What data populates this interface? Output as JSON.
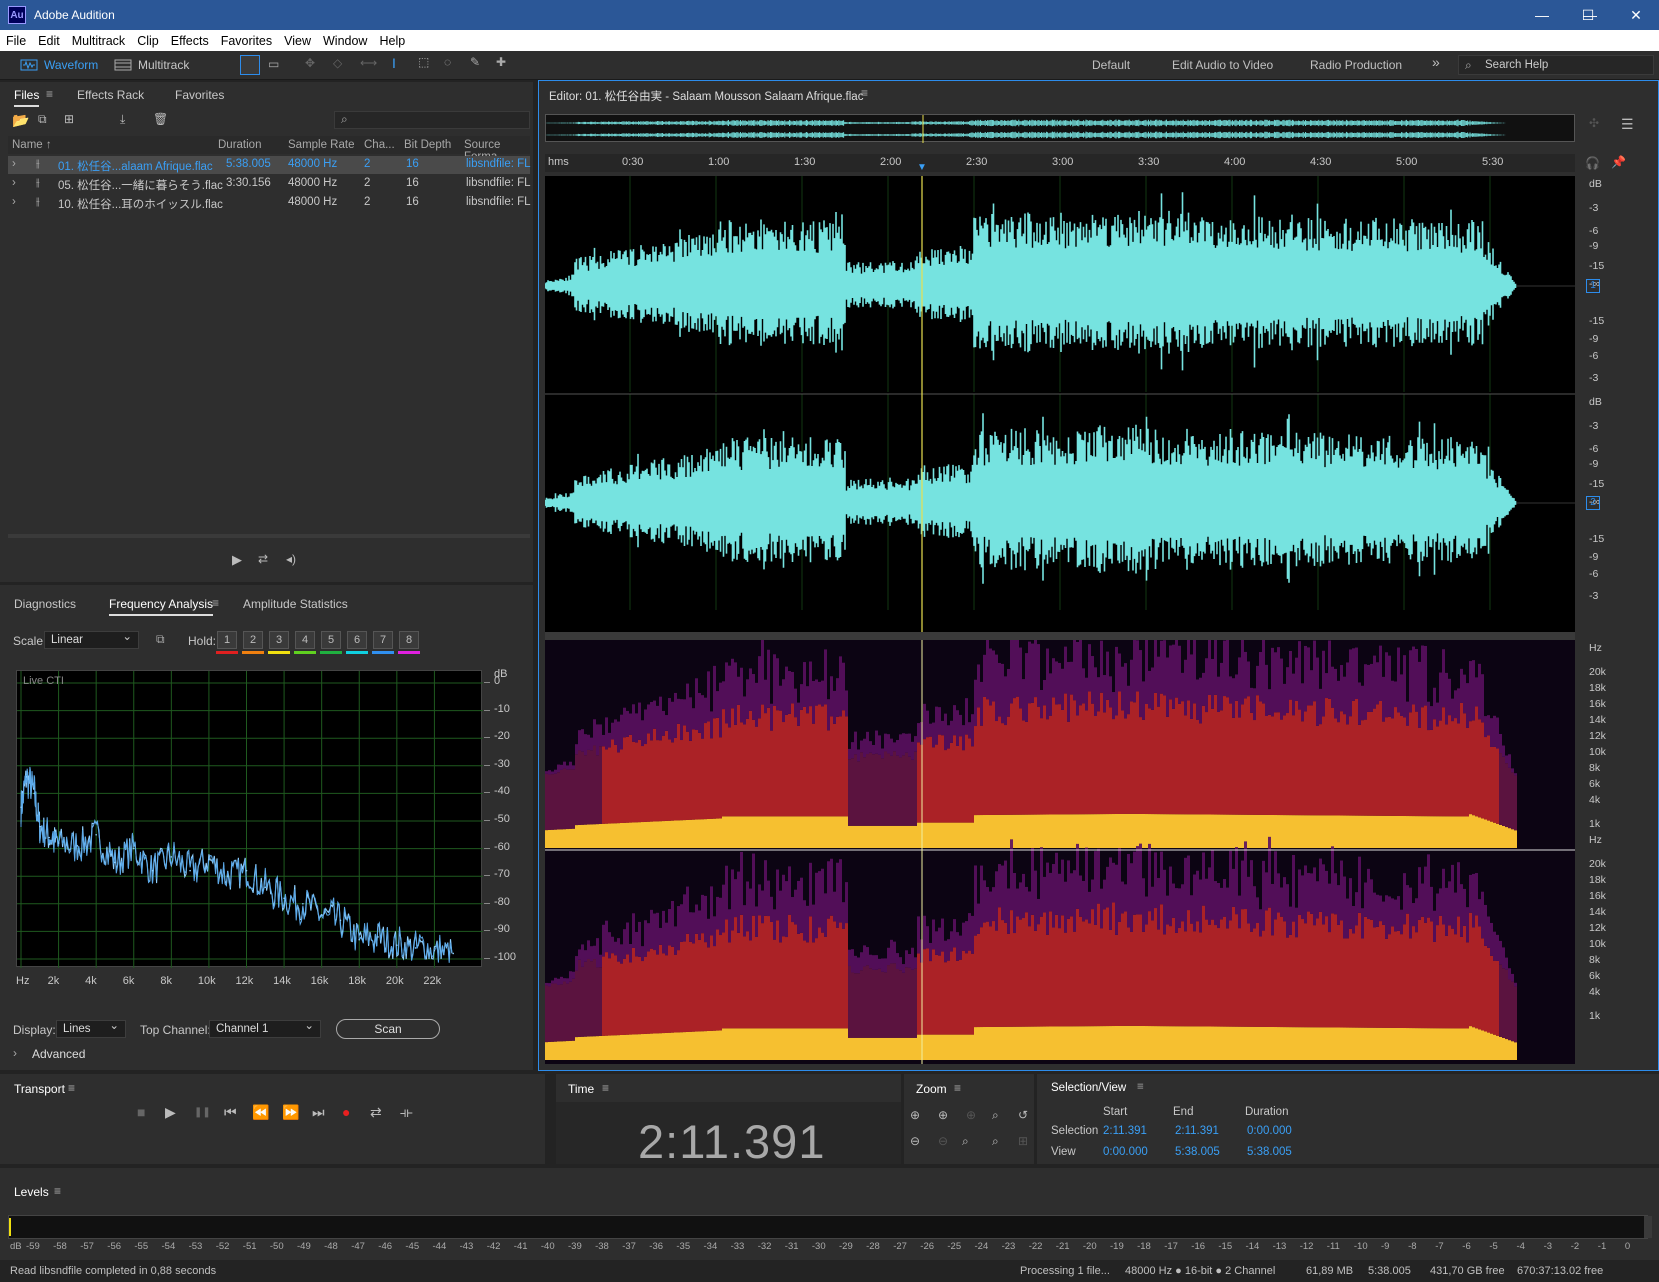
{
  "app": {
    "logo": "Au",
    "title": "Adobe Audition",
    "win_controls": [
      "—",
      "☐",
      "✕"
    ]
  },
  "menu": [
    "File",
    "Edit",
    "Multitrack",
    "Clip",
    "Effects",
    "Favorites",
    "View",
    "Window",
    "Help"
  ],
  "toolbar": {
    "waveform": "Waveform",
    "multitrack": "Multitrack",
    "workspaces": [
      "Default",
      "Edit Audio to Video",
      "Radio Production"
    ],
    "more": "»",
    "search_placeholder": "Search Help"
  },
  "files_panel": {
    "tabs": [
      "Files",
      "Effects Rack",
      "Favorites"
    ],
    "columns": [
      "Name ↑",
      "Duration",
      "Sample Rate",
      "Cha...",
      "Bit Depth",
      "Source Forma"
    ],
    "rows": [
      {
        "name": "01. 松任谷...alaam Afrique.flac",
        "duration": "5:38.005",
        "rate": "48000 Hz",
        "ch": "2",
        "bits": "16",
        "src": "libsndfile: FL"
      },
      {
        "name": "05. 松任谷...一緒に暮らそう.flac",
        "duration": "3:30.156",
        "rate": "48000 Hz",
        "ch": "2",
        "bits": "16",
        "src": "libsndfile: FL"
      },
      {
        "name": "10. 松任谷...耳のホイッスル.flac",
        "duration": "",
        "rate": "48000 Hz",
        "ch": "2",
        "bits": "16",
        "src": "libsndfile: FL"
      }
    ]
  },
  "analysis": {
    "tabs": [
      "Diagnostics",
      "Frequency Analysis",
      "Amplitude Statistics"
    ],
    "scale_label": "Scale:",
    "scale_value": "Linear",
    "hold_label": "Hold:",
    "hold": [
      "1",
      "2",
      "3",
      "4",
      "5",
      "6",
      "7",
      "8"
    ],
    "hold_colors": [
      "#e02020",
      "#f08010",
      "#f0e010",
      "#60d020",
      "#20b040",
      "#10d0e0",
      "#3090f0",
      "#e020e0"
    ],
    "live": "Live CTI",
    "db_ticks": [
      "dB",
      "0",
      "-10",
      "-20",
      "-30",
      "-40",
      "-50",
      "-60",
      "-70",
      "-80",
      "-90",
      "-100"
    ],
    "hz_ticks": [
      "Hz",
      "2k",
      "4k",
      "6k",
      "8k",
      "10k",
      "12k",
      "14k",
      "16k",
      "18k",
      "20k",
      "22k"
    ],
    "display_label": "Display:",
    "display_value": "Lines",
    "top_channel_label": "Top Channel:",
    "top_channel_value": "Channel 1",
    "scan": "Scan",
    "advanced": "Advanced",
    "chart_data": {
      "type": "line",
      "xlabel": "Hz",
      "ylabel": "dB",
      "ylim": [
        -100,
        0
      ],
      "xlim": [
        0,
        24000
      ],
      "x": [
        0,
        300,
        700,
        1000,
        1500,
        2000,
        3000,
        4000,
        5000,
        6000,
        7000,
        8000,
        9000,
        10000,
        11000,
        12000,
        13000,
        14000,
        15000,
        16000,
        17000,
        18000,
        19000,
        20000,
        21000,
        22000,
        23000
      ],
      "y": [
        -45,
        -34,
        -40,
        -52,
        -56,
        -58,
        -59,
        -55,
        -65,
        -60,
        -68,
        -63,
        -68,
        -64,
        -70,
        -68,
        -74,
        -78,
        -80,
        -84,
        -86,
        -93,
        -92,
        -95,
        -96,
        -97,
        -98
      ]
    }
  },
  "editor": {
    "title": "Editor: 01. 松任谷由実 - Salaam Mousson Salaam Afrique.flac",
    "ruler": [
      "hms",
      "0:30",
      "1:00",
      "1:30",
      "2:00",
      "2:30",
      "3:00",
      "3:30",
      "4:00",
      "4:30",
      "5:00",
      "5:30"
    ],
    "amp_ticks": [
      "dB",
      "-3",
      "-6",
      "-9",
      "-15",
      "-∞",
      "-15",
      "-9",
      "-6",
      "-3"
    ],
    "spec_ticks": [
      "Hz",
      "20k",
      "18k",
      "16k",
      "14k",
      "12k",
      "10k",
      "8k",
      "6k",
      "4k",
      "1k"
    ],
    "channels": [
      "1",
      "2"
    ]
  },
  "transport": {
    "title": "Transport",
    "buttons": [
      "■",
      "▶",
      "❚❚",
      "⏮",
      "⏪",
      "⏩",
      "⏭",
      "●",
      "⇄",
      "⟛"
    ]
  },
  "time": {
    "title": "Time",
    "value": "2:11.391"
  },
  "zoom": {
    "title": "Zoom"
  },
  "selview": {
    "title": "Selection/View",
    "cols": [
      "Start",
      "End",
      "Duration"
    ],
    "selection_label": "Selection",
    "view_label": "View",
    "selection": [
      "2:11.391",
      "2:11.391",
      "0:00.000"
    ],
    "view": [
      "0:00.000",
      "5:38.005",
      "5:38.005"
    ]
  },
  "levels": {
    "title": "Levels",
    "ticks": [
      "dB",
      "-59",
      "-58",
      "-57",
      "-56",
      "-55",
      "-54",
      "-53",
      "-52",
      "-51",
      "-50",
      "-49",
      "-48",
      "-47",
      "-46",
      "-45",
      "-44",
      "-43",
      "-42",
      "-41",
      "-40",
      "-39",
      "-38",
      "-37",
      "-36",
      "-35",
      "-34",
      "-33",
      "-32",
      "-31",
      "-30",
      "-29",
      "-28",
      "-27",
      "-26",
      "-25",
      "-24",
      "-23",
      "-22",
      "-21",
      "-20",
      "-19",
      "-18",
      "-17",
      "-16",
      "-15",
      "-14",
      "-13",
      "-12",
      "-11",
      "-10",
      "-9",
      "-8",
      "-7",
      "-6",
      "-5",
      "-4",
      "-3",
      "-2",
      "-1",
      "0"
    ]
  },
  "status": {
    "left": "Read libsndfile completed in 0,88 seconds",
    "processing": "Processing 1 file...",
    "format": "48000 Hz ● 16-bit ● 2 Channel",
    "size": "61,89 MB",
    "duration": "5:38.005",
    "free": "431,70 GB free",
    "time_free": "670:37:13.02 free"
  }
}
